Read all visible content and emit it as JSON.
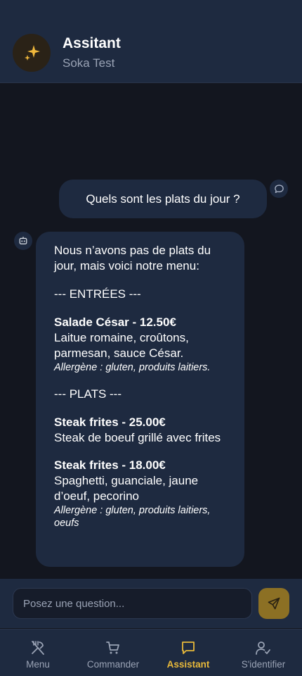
{
  "header": {
    "title": "Assitant",
    "subtitle": "Soka Test",
    "avatar_icon": "sparkles-icon"
  },
  "chat": {
    "user_message": "Quels sont les plats du jour ?",
    "bot_message": {
      "intro": "Nous n’avons pas de plats du jour, mais voici notre menu:",
      "section_entrees": "--- ENTRÉES ---",
      "dish1_name": "Salade César - 12.50€",
      "dish1_desc": "Laitue romaine, croûtons, parmesan, sauce César.",
      "dish1_allergen": "Allergène : gluten, produits laitiers.",
      "section_plats": "--- PLATS ---",
      "dish2_name": "Steak frites - 25.00€",
      "dish2_desc": "Steak de boeuf grillé avec frites",
      "dish3_name": "Steak frites - 18.00€",
      "dish3_desc": "Spaghetti, guanciale, jaune d’oeuf, pecorino",
      "dish3_allergen": "Allergène : gluten, produits laitiers, oeufs"
    }
  },
  "input": {
    "placeholder": "Posez une question..."
  },
  "nav": {
    "items": [
      {
        "label": "Menu",
        "icon": "utensils-icon"
      },
      {
        "label": "Commander",
        "icon": "cart-icon"
      },
      {
        "label": "Assistant",
        "icon": "chat-icon",
        "active": true
      },
      {
        "label": "S'identifier",
        "icon": "user-check-icon"
      }
    ]
  },
  "colors": {
    "accent": "#e8b93a",
    "send_button": "#8c7024",
    "surface": "#1e2a40",
    "background": "#13161f"
  }
}
